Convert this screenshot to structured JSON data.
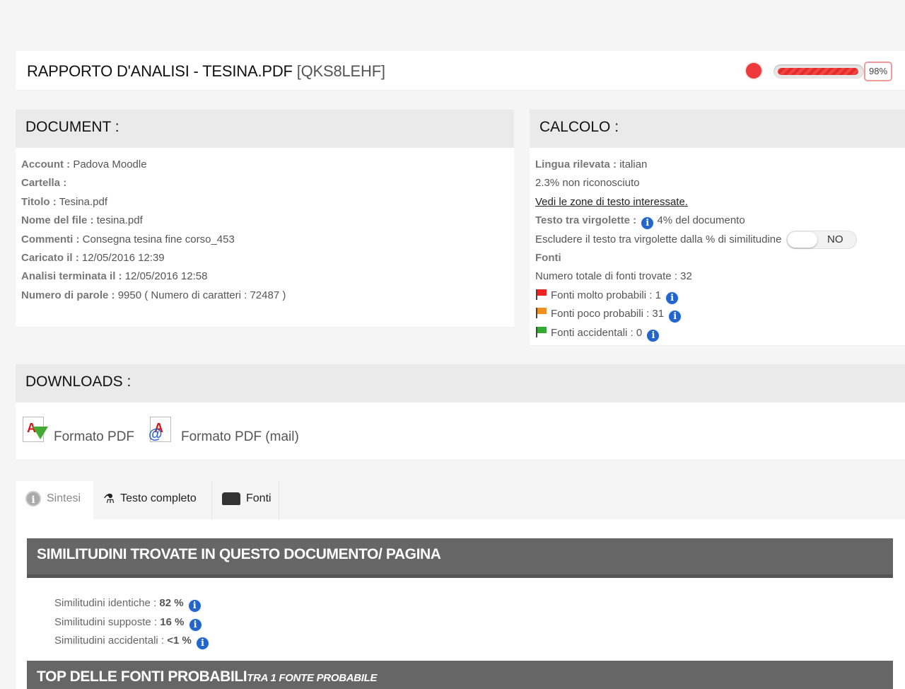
{
  "header": {
    "title": "RAPPORTO D'ANALISI - TESINA.PDF",
    "code": "[QKS8LEHF]",
    "progress_percent": 98,
    "progress_label": "98%",
    "status_color": "#f0393a"
  },
  "document": {
    "heading": "DOCUMENT :",
    "rows": [
      {
        "label": "Account :",
        "value": " Padova Moodle"
      },
      {
        "label": "Cartella :",
        "value": ""
      },
      {
        "label": "Titolo :",
        "value": " Tesina.pdf"
      },
      {
        "label": "Nome del file :",
        "value": " tesina.pdf"
      },
      {
        "label": "Commenti :",
        "value": " Consegna tesina fine corso_453"
      },
      {
        "label": "Caricato il :",
        "value": " 12/05/2016 12:39"
      },
      {
        "label": "Analisi terminata il :",
        "value": " 12/05/2016 12:58"
      },
      {
        "label": "Numero di parole :",
        "value": " 9950 ( Numero di caratteri : 72487 )"
      }
    ]
  },
  "calcolo": {
    "heading": "CALCOLO :",
    "lingua_label": "Lingua rilevata :",
    "lingua_value": " italian",
    "non_riconosciuto": "2.3% non riconosciuto",
    "link_zone": "Vedi le zone di testo interessate.",
    "virgolette_label": "Testo tra virgolette :",
    "virgolette_value": "4% del documento",
    "escludere_text": "Escludere il testo tra virgolette dalla % di similitudine",
    "toggle_value": "NO",
    "fonti_heading": "Fonti",
    "totale_fonti": "Numero totale di fonti trovate : 32",
    "fonti_molto": "Fonti molto probabili : 1",
    "fonti_poco": "Fonti poco probabili : 31",
    "fonti_accidentali": "Fonti accidentali : 0"
  },
  "downloads": {
    "heading": "DOWNLOADS :",
    "pdf_label": "Formato PDF",
    "pdf_mail_label": "Formato PDF (mail)"
  },
  "tabs": [
    {
      "label": "Sintesi",
      "icon": "info-circle-icon"
    },
    {
      "label": "Testo completo",
      "icon": "flask-icon"
    },
    {
      "label": "Fonti",
      "icon": "inbox-icon"
    }
  ],
  "sintesi": {
    "bar_title": "SIMILITUDINI TROVATE IN QUESTO DOCUMENTO/ PAGINA",
    "identiche_label": "Similitudini identiche : ",
    "identiche_value": "82 %",
    "supposte_label": "Similitudini supposte : ",
    "supposte_value": "16 %",
    "accidentali_label": "Similitudini accidentali : ",
    "accidentali_value": "<1 %",
    "top_title": "TOP DELLE FONTI PROBABILI",
    "top_sub": "TRA 1 FONTE PROBABILE"
  }
}
